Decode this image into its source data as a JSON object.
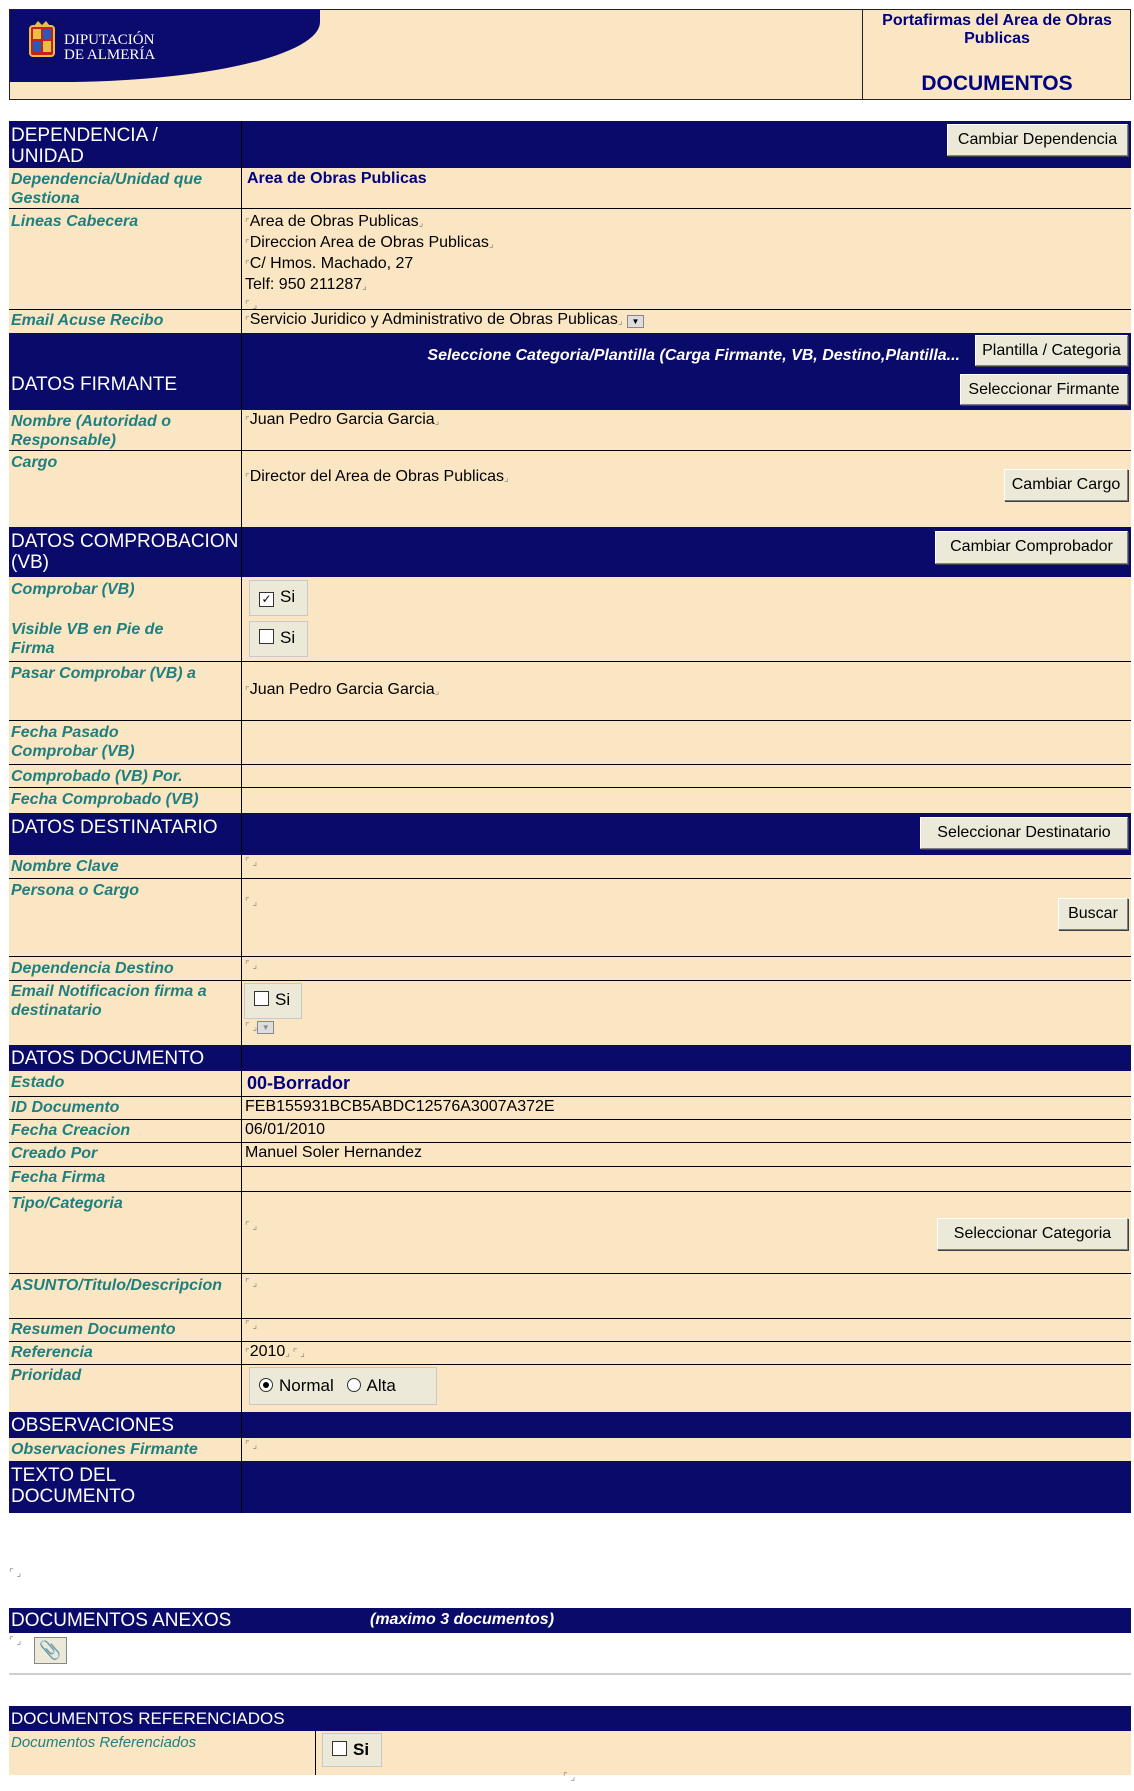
{
  "header": {
    "org_line1": "DIPUTACIÓN",
    "org_line2": "DE ALMERÍA",
    "app_title": "Portafirmas del Area de Obras Publicas",
    "view_title": "DOCUMENTOS"
  },
  "dependencia": {
    "section": "DEPENDENCIA / UNIDAD",
    "change_button": "Cambiar Dependencia",
    "gestiona_label": "Dependencia/Unidad que Gestiona",
    "gestiona_value": "Area de Obras Publicas",
    "cabecera_label": "Lineas Cabecera",
    "cabecera_lines": [
      "Area de Obras Publicas",
      "Direccion Area de Obras Publicas",
      "C/ Hmos. Machado, 27",
      "Telf: 950 211287"
    ],
    "email_label": "Email Acuse Recibo",
    "email_value": "Servicio Juridico y Administrativo de Obras Publicas"
  },
  "plantilla": {
    "hint": "Seleccione Categoria/Plantilla (Carga Firmante, VB, Destino,Plantilla...",
    "button": "Plantilla / Categoria"
  },
  "firmante": {
    "section": "DATOS FIRMANTE",
    "select_button": "Seleccionar Firmante",
    "nombre_label": "Nombre (Autoridad o Responsable)",
    "nombre_value": "Juan Pedro Garcia Garcia",
    "cargo_label": "Cargo",
    "cargo_value": "Director del Area de Obras Publicas",
    "cargo_button": "Cambiar Cargo"
  },
  "comprobacion": {
    "section": "DATOS COMPROBACION (VB)",
    "button": "Cambiar Comprobador",
    "comprobar_label": "Comprobar (VB)",
    "comprobar_option": "Si",
    "comprobar_checked": true,
    "visible_label": "Visible VB en Pie de Firma",
    "visible_option": "Si",
    "visible_checked": false,
    "pasar_label": "Pasar Comprobar (VB) a",
    "pasar_value": "Juan Pedro Garcia Garcia",
    "fecha_pasado_label": "Fecha Pasado Comprobar (VB)",
    "comprobado_por_label": "Comprobado (VB) Por.",
    "fecha_comprobado_label": "Fecha Comprobado (VB)"
  },
  "destinatario": {
    "section": "DATOS DESTINATARIO",
    "button": "Seleccionar Destinatario",
    "nombre_clave_label": "Nombre Clave",
    "persona_label": "Persona o Cargo",
    "buscar_button": "Buscar",
    "dependencia_label": "Dependencia Destino",
    "email_label": "Email Notificacion firma a destinatario",
    "email_option": "Si",
    "email_checked": false
  },
  "documento": {
    "section": "DATOS DOCUMENTO",
    "estado_label": "Estado",
    "estado_value": "00-Borrador",
    "id_label": "ID Documento",
    "id_value": "FEB155931BCB5ABDC12576A3007A372E",
    "fecha_creacion_label": "Fecha Creacion",
    "fecha_creacion_value": "06/01/2010",
    "creado_por_label": "Creado Por",
    "creado_por_value": "Manuel Soler Hernandez",
    "fecha_firma_label": "Fecha Firma",
    "tipo_label": "Tipo/Categoria",
    "tipo_button": "Seleccionar Categoria",
    "asunto_label": "ASUNTO/Titulo/Descripcion",
    "resumen_label": "Resumen Documento",
    "referencia_label": "Referencia",
    "referencia_value": "2010",
    "prioridad_label": "Prioridad",
    "prioridad_options": [
      "Normal",
      "Alta"
    ],
    "prioridad_selected": "Normal"
  },
  "observaciones": {
    "section": "OBSERVACIONES",
    "firmante_label": "Observaciones Firmante"
  },
  "texto": {
    "section": "TEXTO DEL DOCUMENTO"
  },
  "anexos": {
    "section": "DOCUMENTOS ANEXOS",
    "note": "(maximo 3 documentos)"
  },
  "referenciados": {
    "section": "DOCUMENTOS REFERENCIADOS",
    "label": "Documentos Referenciados",
    "option": "Si",
    "checked": false
  },
  "colors": {
    "navy": "#0a0a6b",
    "beige": "#fbe6c4",
    "label_teal": "#1f7f7f",
    "title_blue": "#000080"
  }
}
